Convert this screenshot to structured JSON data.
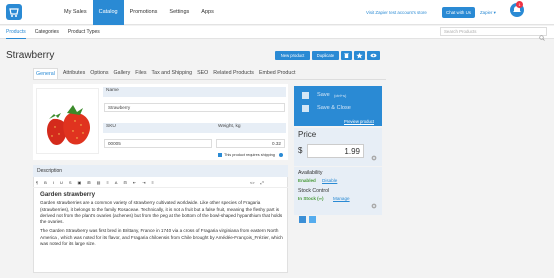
{
  "topnav": {
    "items": [
      "My Sales",
      "Catalog",
      "Promotions",
      "Settings",
      "Apps"
    ],
    "active": "Catalog",
    "test_account_link": "Visit Zapier test account's store",
    "chat_button": "Chat with Us",
    "user_menu": "Zapier ▾",
    "notification_count": "1"
  },
  "subnav": {
    "items": [
      "Products",
      "Categories",
      "Product Types"
    ],
    "active": "Products",
    "search_placeholder": "Search Products"
  },
  "product": {
    "title": "Strawberry",
    "actions": [
      "New product",
      "Duplicate"
    ]
  },
  "tabs": {
    "items": [
      "General",
      "Attributes",
      "Options",
      "Gallery",
      "Files",
      "Tax and Shipping",
      "SEO",
      "Related Products",
      "Embed Product"
    ],
    "active": "General"
  },
  "form": {
    "name_label": "Name",
    "name_value": "Strawberry",
    "sku_label": "SKU",
    "sku_value": "00005",
    "weight_label": "Weight, kg",
    "weight_value": "0.32",
    "requires_shipping": "This product requires shipping"
  },
  "description": {
    "label": "Description",
    "toolbar": [
      "¶",
      "B",
      "I",
      "U",
      "S",
      "▣",
      "⊞",
      "▤",
      "≡",
      "A",
      "⊟",
      "⇤",
      "⇥",
      "≡",
      "<>",
      "⤢"
    ],
    "heading": "Garden strawberry",
    "paragraphs": [
      "Garden strawberries are a common variety of strawberry cultivated worldwide. Like other species of Fragaria (strawberries), it belongs to the family Rosaceae. Technically, it is not a fruit but a false fruit, meaning the fleshy part is derived not from the plant's ovaries (achenes) but from the peg at the bottom of the bowl-shaped hypanthium that holds the ovaries.",
      "The Garden Strawberry was first bred in Brittany, France in 1740 via a cross of Fragaria virginiana from eastern North America , which was noted for its flavor, and Fragaria chiloensis from Chile brought by Amédée-François_Frézier, which was noted for its large size."
    ]
  },
  "side": {
    "save": "Save",
    "save_hint": "(ctrl+s)",
    "save_close": "Save & Close",
    "preview": "Preview product",
    "price_label": "Price",
    "currency": "$",
    "price_value": "1.99",
    "availability_label": "Availability",
    "availability_value": "Enabled",
    "disable_link": "Disable",
    "stock_label": "Stock Control",
    "stock_value": "In Stock (∞)",
    "manage_link": "Manage"
  },
  "colors": {
    "accent": "#2a8ad4",
    "panel": "#e7eef6",
    "success": "#4a9a3a"
  }
}
